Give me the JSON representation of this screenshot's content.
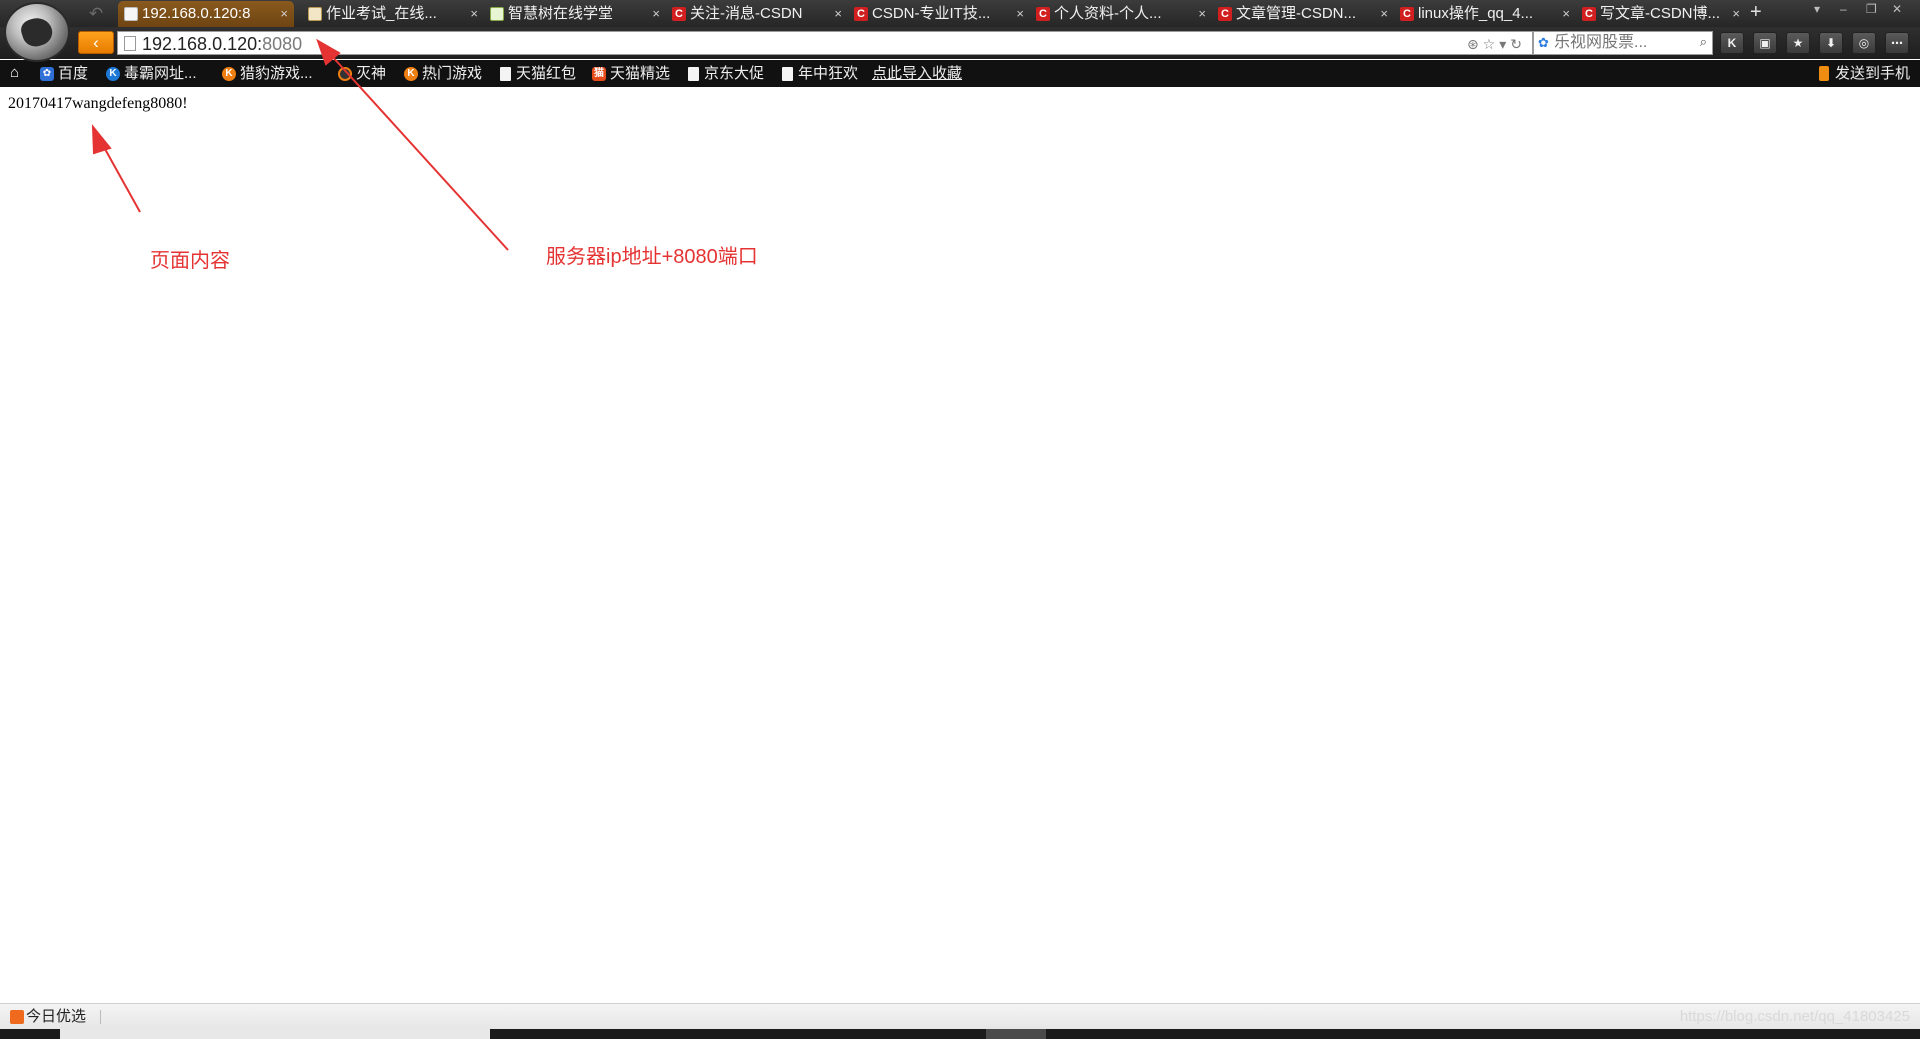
{
  "tabs": [
    {
      "title": "192.168.0.120:8",
      "icon": "blank-page-icon",
      "active": true
    },
    {
      "title": "作业考试_在线...",
      "icon": "zhihuishu-icon"
    },
    {
      "title": "智慧树在线学堂",
      "icon": "zhihuishu-icon"
    },
    {
      "title": "关注-消息-CSDN",
      "icon": "csdn-icon"
    },
    {
      "title": "CSDN-专业IT技...",
      "icon": "csdn-icon"
    },
    {
      "title": "个人资料-个人...",
      "icon": "csdn-icon"
    },
    {
      "title": "文章管理-CSDN...",
      "icon": "csdn-icon"
    },
    {
      "title": "linux操作_qq_4...",
      "icon": "csdn-icon"
    },
    {
      "title": "写文章-CSDN博...",
      "icon": "csdn-icon"
    }
  ],
  "tab_close_glyph": "×",
  "new_tab_glyph": "+",
  "address_bar": {
    "host": "192.168.0.120:",
    "port": "8080"
  },
  "search": {
    "placeholder": "乐视网股票..."
  },
  "bookmarks": [
    {
      "label": "百度",
      "icon": "baidu-icon"
    },
    {
      "label": "毒霸网址...",
      "icon": "k-icon"
    },
    {
      "label": "猎豹游戏...",
      "icon": "cheetah-icon"
    },
    {
      "label": "灭神",
      "icon": "game-icon"
    },
    {
      "label": "热门游戏",
      "icon": "cheetah-icon"
    },
    {
      "label": "天猫红包",
      "icon": "doc-icon"
    },
    {
      "label": "天猫精选",
      "icon": "tmall-icon"
    },
    {
      "label": "京东大促",
      "icon": "doc-icon"
    },
    {
      "label": "年中狂欢",
      "icon": "doc-icon"
    }
  ],
  "import_bookmarks": "点此导入收藏",
  "send_to_phone": "发送到手机",
  "page": {
    "text": "20170417wangdefeng8080!"
  },
  "annotations": {
    "content_label": "页面内容",
    "address_label": "服务器ip地址+8080端口",
    "color": "#e53333"
  },
  "status": {
    "today_label": "今日优选",
    "watermark": "https://blog.csdn.net/qq_41803425"
  }
}
